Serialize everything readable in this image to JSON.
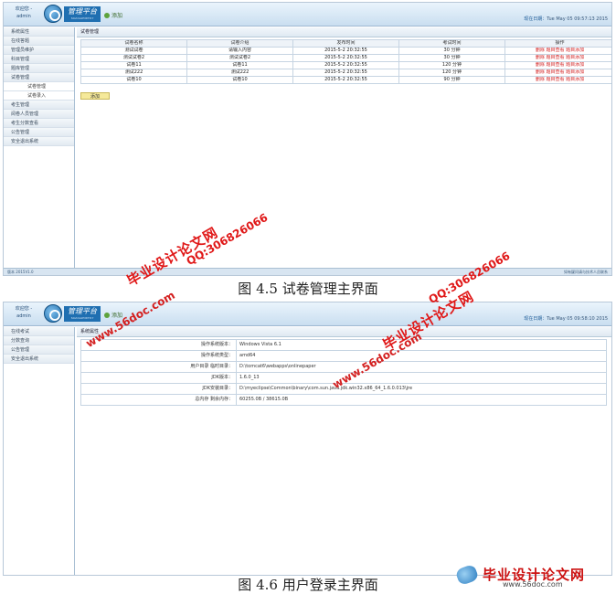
{
  "screen1": {
    "user": {
      "line1": "欢迎您 -",
      "line2": "admin"
    },
    "brand": {
      "title": "管理平台",
      "subtitle": "MANAGEMENT PLATFORM"
    },
    "add_label": "添加",
    "date_label": "现在日期：",
    "date_value": "Tue May 05 09:57:13 2015",
    "sidebar": [
      {
        "label": "系统属性",
        "sub": false
      },
      {
        "label": "在线答题",
        "sub": false
      },
      {
        "label": "管理员维护",
        "sub": false
      },
      {
        "label": "科目管理",
        "sub": false
      },
      {
        "label": "题库管理",
        "sub": false
      },
      {
        "label": "试卷管理",
        "sub": false
      },
      {
        "label": "试卷管理",
        "sub": true
      },
      {
        "label": "试卷录入",
        "sub": true
      },
      {
        "label": "考生管理",
        "sub": false
      },
      {
        "label": "阅卷人员管理",
        "sub": false
      },
      {
        "label": "考生分数查看",
        "sub": false
      },
      {
        "label": "公告管理",
        "sub": false
      },
      {
        "label": "安全退出系统",
        "sub": false
      }
    ],
    "panel_title": "试卷管理",
    "table": {
      "headers": [
        "试卷名称",
        "试卷介绍",
        "发布时间",
        "考试时间",
        "操作"
      ],
      "rows": [
        [
          "测试试卷",
          "请输入内容",
          "2015-5-2 20:32:55",
          "30 分钟",
          "删除 题目查看 题目添加"
        ],
        [
          "测试试卷2",
          "测试试卷2",
          "2015-5-2 20:32:55",
          "30 分钟",
          "删除 题目查看 题目添加"
        ],
        [
          "试卷11",
          "试卷11",
          "2015-5-2 20:32:55",
          "120 分钟",
          "删除 题目查看 题目添加"
        ],
        [
          "测试222",
          "测试222",
          "2015-5-2 20:32:55",
          "120 分钟",
          "删除 题目查看 题目添加"
        ],
        [
          "试卷10",
          "试卷10",
          "2015-5-2 20:32:55",
          "90 分钟",
          "删除 题目查看 题目添加"
        ]
      ]
    },
    "add_button": "添加",
    "status_left": "版本 2015V1.0",
    "status_right": "如有疑问请与技术人员联系"
  },
  "caption1": "图 4.5  试卷管理主界面",
  "screen2": {
    "user": {
      "line1": "欢迎您 -",
      "line2": "admin"
    },
    "brand": {
      "title": "管理平台",
      "subtitle": "MANAGEMENT PLATFORM"
    },
    "add_label": "添加",
    "date_label": "现在日期：",
    "date_value": "Tue May 05 09:58:10 2015",
    "sidebar": [
      {
        "label": "在线考试",
        "sub": false
      },
      {
        "label": "分数查询",
        "sub": false
      },
      {
        "label": "公告管理",
        "sub": false
      },
      {
        "label": "安全退出系统",
        "sub": false
      }
    ],
    "panel_title": "系统属性",
    "sys_info": [
      {
        "key": "操作系统版本：",
        "value": "Windows Vista  6.1"
      },
      {
        "key": "操作系统类型：",
        "value": "amd64"
      },
      {
        "key": "用户目录 临时目录：",
        "value": "D:\\tomcat6\\webapps\\onlinepaper"
      },
      {
        "key": "JDK版本：",
        "value": "1.6.0_13"
      },
      {
        "key": "JDK安装目录：",
        "value": "D:\\myeclipse\\Common\\binary\\com.sun.java.jdk.win32.x86_64_1.6.0.013\\jre"
      },
      {
        "key": "总内存 剩余内存：",
        "value": "60255.0B  /  38615.0B"
      }
    ]
  },
  "caption2": "图 4.6  用户登录主界面",
  "watermarks": {
    "cn": "毕业设计论文网",
    "qq": "QQ:306826066",
    "url": "www.56doc.com"
  },
  "footer_logo": {
    "name": "毕业设计论文网",
    "url": "www.56doc.com"
  }
}
